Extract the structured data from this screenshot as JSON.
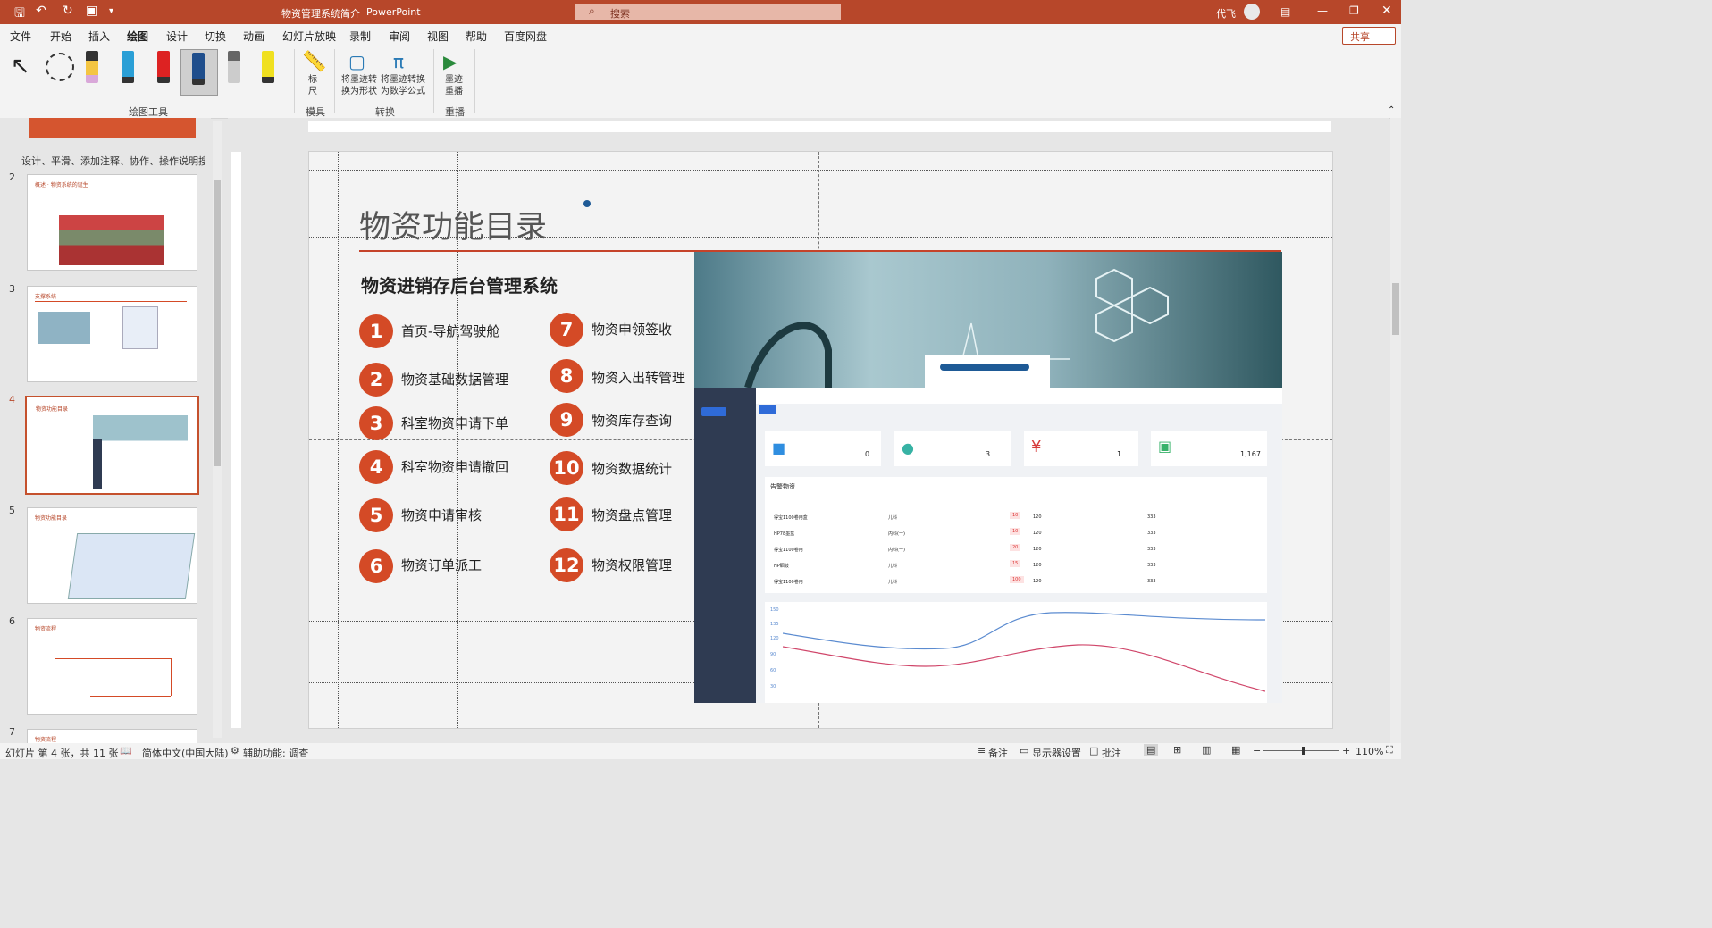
{
  "window": {
    "doc_title": "物资管理系统简介",
    "app_name": "PowerPoint",
    "search_placeholder": "搜索",
    "user_name": "代飞",
    "share_label": "共享"
  },
  "menu": [
    "文件",
    "开始",
    "插入",
    "绘图",
    "设计",
    "切换",
    "动画",
    "幻灯片放映",
    "录制",
    "审阅",
    "视图",
    "帮助",
    "百度网盘"
  ],
  "ribbon": {
    "groups": {
      "drawing_tools": "绘图工具",
      "stencils": "模具",
      "convert": "转换",
      "replay": "重播"
    },
    "ruler_label": "标尺",
    "ink_to_shape": "将墨迹转换为形状",
    "ink_to_math": "将墨迹转换为数学公式",
    "ink_replay": "墨迹重播"
  },
  "thumbnails": {
    "section_text": "设计、平滑、添加注释、协作、操作说明搜...",
    "items": [
      {
        "num": "2",
        "title": "概述 · 物资系统的诞生"
      },
      {
        "num": "3",
        "title": "支撑系统"
      },
      {
        "num": "4",
        "title": "物资功能目录"
      },
      {
        "num": "5",
        "title": "物资功能目录"
      },
      {
        "num": "6",
        "title": "物资流程"
      },
      {
        "num": "7",
        "title": "物资流程"
      }
    ]
  },
  "slide": {
    "title": "物资功能目录",
    "subtitle": "物资进销存后台管理系统",
    "functions": [
      {
        "num": "1",
        "label": "首页-导航驾驶舱"
      },
      {
        "num": "2",
        "label": "物资基础数据管理"
      },
      {
        "num": "3",
        "label": "科室物资申请下单"
      },
      {
        "num": "4",
        "label": "科室物资申请撤回"
      },
      {
        "num": "5",
        "label": "物资申请审核"
      },
      {
        "num": "6",
        "label": "物资订单派工"
      },
      {
        "num": "7",
        "label": "物资申领签收"
      },
      {
        "num": "8",
        "label": "物资入出转管理"
      },
      {
        "num": "9",
        "label": "物资库存查询"
      },
      {
        "num": "10",
        "label": "物资数据统计"
      },
      {
        "num": "11",
        "label": "物资盘点管理"
      },
      {
        "num": "12",
        "label": "物资权限管理"
      }
    ],
    "screenshot": {
      "stat_values": [
        "0",
        "3",
        "1",
        "1,167"
      ],
      "warning_title": "告警物资",
      "table_rows": [
        {
          "name": "得宝1100卷用盒",
          "dept": "儿科",
          "qty": "10",
          "low": "120",
          "high": "333"
        },
        {
          "name": "HP78墨盒",
          "dept": "内科(一)",
          "qty": "10",
          "low": "120",
          "high": "333"
        },
        {
          "name": "得宝1100卷用",
          "dept": "内科(一)",
          "qty": "20",
          "low": "120",
          "high": "333"
        },
        {
          "name": "HP硒鼓",
          "dept": "儿科",
          "qty": "15",
          "low": "120",
          "high": "333"
        },
        {
          "name": "得宝1100卷用",
          "dept": "儿科",
          "qty": "100",
          "low": "120",
          "high": "333"
        }
      ],
      "y_ticks": [
        "150",
        "135",
        "120",
        "90",
        "60",
        "30"
      ]
    }
  },
  "status": {
    "slide_info": "幻灯片 第 4 张，共 11 张",
    "language": "简体中文(中国大陆)",
    "accessibility": "辅助功能: 调查",
    "notes": "备注",
    "display_settings": "显示器设置",
    "comments": "批注",
    "zoom": "110%"
  },
  "colors": {
    "accent": "#b7472a",
    "circle": "#d44a26",
    "dark_sidebar": "#2f3b52"
  }
}
